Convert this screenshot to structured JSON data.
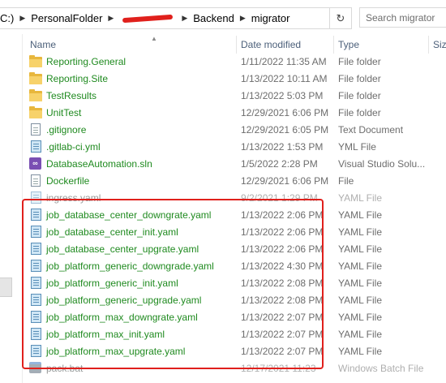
{
  "address": {
    "crumbs": [
      "C:)",
      "PersonalFolder",
      "Backend",
      "migrator"
    ],
    "refresh_icon": "refresh-icon"
  },
  "search": {
    "placeholder": "Search migrator"
  },
  "columns": {
    "name": "Name",
    "date": "Date modified",
    "type": "Type",
    "size": "Siz"
  },
  "files": [
    {
      "name": "Reporting.General",
      "date": "1/11/2022 11:35 AM",
      "type": "File folder",
      "icon": "folder"
    },
    {
      "name": "Reporting.Site",
      "date": "1/13/2022 10:11 AM",
      "type": "File folder",
      "icon": "folder"
    },
    {
      "name": "TestResults",
      "date": "1/13/2022 5:03 PM",
      "type": "File folder",
      "icon": "folder"
    },
    {
      "name": "UnitTest",
      "date": "12/29/2021 6:06 PM",
      "type": "File folder",
      "icon": "folder"
    },
    {
      "name": ".gitignore",
      "date": "12/29/2021 6:05 PM",
      "type": "Text Document",
      "icon": "doc"
    },
    {
      "name": ".gitlab-ci.yml",
      "date": "1/13/2022 1:53 PM",
      "type": "YML File",
      "icon": "yaml"
    },
    {
      "name": "DatabaseAutomation.sln",
      "date": "1/5/2022 2:28 PM",
      "type": "Visual Studio Solu...",
      "icon": "sln"
    },
    {
      "name": "Dockerfile",
      "date": "12/29/2021 6:06 PM",
      "type": "File",
      "icon": "doc"
    },
    {
      "name": "ingress.yaml",
      "date": "9/2/2021 1:29 PM",
      "type": "YAML File",
      "icon": "yaml"
    },
    {
      "name": "job_database_center_downgrate.yaml",
      "date": "1/13/2022 2:06 PM",
      "type": "YAML File",
      "icon": "yaml"
    },
    {
      "name": "job_database_center_init.yaml",
      "date": "1/13/2022 2:06 PM",
      "type": "YAML File",
      "icon": "yaml"
    },
    {
      "name": "job_database_center_upgrate.yaml",
      "date": "1/13/2022 2:06 PM",
      "type": "YAML File",
      "icon": "yaml"
    },
    {
      "name": "job_platform_generic_downgrade.yaml",
      "date": "1/13/2022 4:30 PM",
      "type": "YAML File",
      "icon": "yaml"
    },
    {
      "name": "job_platform_generic_init.yaml",
      "date": "1/13/2022 2:08 PM",
      "type": "YAML File",
      "icon": "yaml"
    },
    {
      "name": "job_platform_generic_upgrade.yaml",
      "date": "1/13/2022 2:08 PM",
      "type": "YAML File",
      "icon": "yaml"
    },
    {
      "name": "job_platform_max_downgrate.yaml",
      "date": "1/13/2022 2:07 PM",
      "type": "YAML File",
      "icon": "yaml"
    },
    {
      "name": "job_platform_max_init.yaml",
      "date": "1/13/2022 2:07 PM",
      "type": "YAML File",
      "icon": "yaml"
    },
    {
      "name": "job_platform_max_upgrate.yaml",
      "date": "1/13/2022 2:07 PM",
      "type": "YAML File",
      "icon": "yaml"
    },
    {
      "name": "pack.bat",
      "date": "12/17/2021 11:23",
      "type": "Windows Batch File",
      "icon": "bat"
    }
  ],
  "highlight_color": "#e0201c",
  "name_color": "#1f8a1f"
}
